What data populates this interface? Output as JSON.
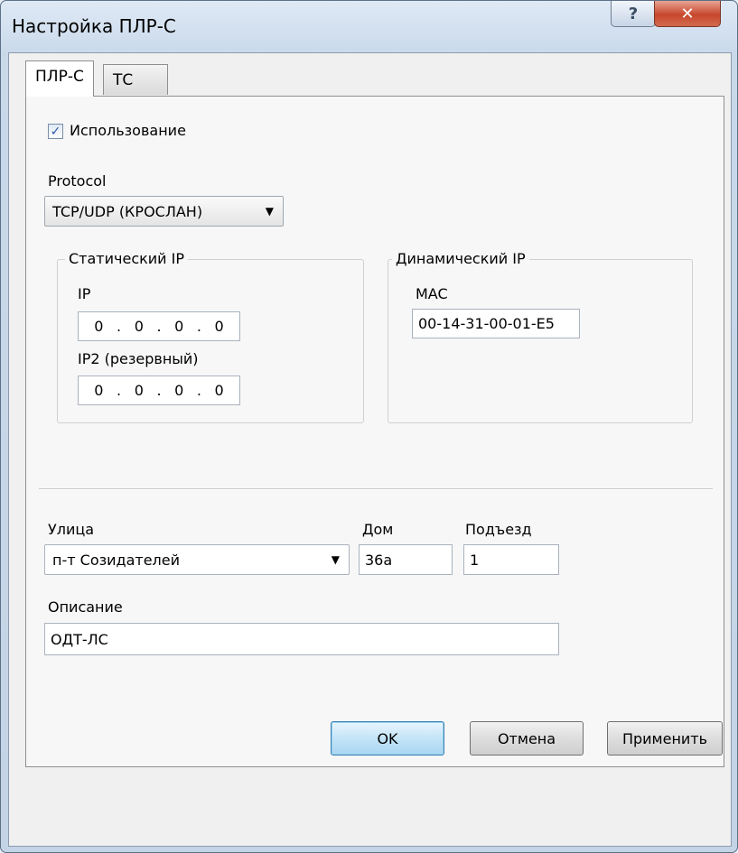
{
  "window": {
    "title": "Настройка ПЛР-С",
    "help": "?",
    "close": "✕"
  },
  "tabs": [
    {
      "label": "ПЛР-С",
      "active": true
    },
    {
      "label": "ТС",
      "active": false
    }
  ],
  "usage": {
    "label": "Использование",
    "checked": true,
    "check_glyph": "✓"
  },
  "protocol": {
    "label": "Protocol",
    "value": "TCP/UDP (КРОСЛАН)",
    "arrow": "▼"
  },
  "static_ip": {
    "title": "Статический IP",
    "ip_label": "IP",
    "ip_parts": [
      "0",
      ".",
      "0",
      ".",
      "0",
      ".",
      "0"
    ],
    "ip2_label": "IP2 (резервный)",
    "ip2_parts": [
      "0",
      ".",
      "0",
      ".",
      "0",
      ".",
      "0"
    ]
  },
  "dynamic_ip": {
    "title": "Динамический IP",
    "mac_label": "MAC",
    "mac_value": "00-14-31-00-01-E5"
  },
  "address": {
    "street_label": "Улица",
    "street_value": "п-т Созидателей",
    "street_arrow": "▼",
    "house_label": "Дом",
    "house_value": "36а",
    "entrance_label": "Подъезд",
    "entrance_value": "1"
  },
  "description": {
    "label": "Описание",
    "value": "ОДТ-ЛС"
  },
  "buttons": {
    "ok": "OK",
    "cancel": "Отмена",
    "apply": "Применить"
  }
}
